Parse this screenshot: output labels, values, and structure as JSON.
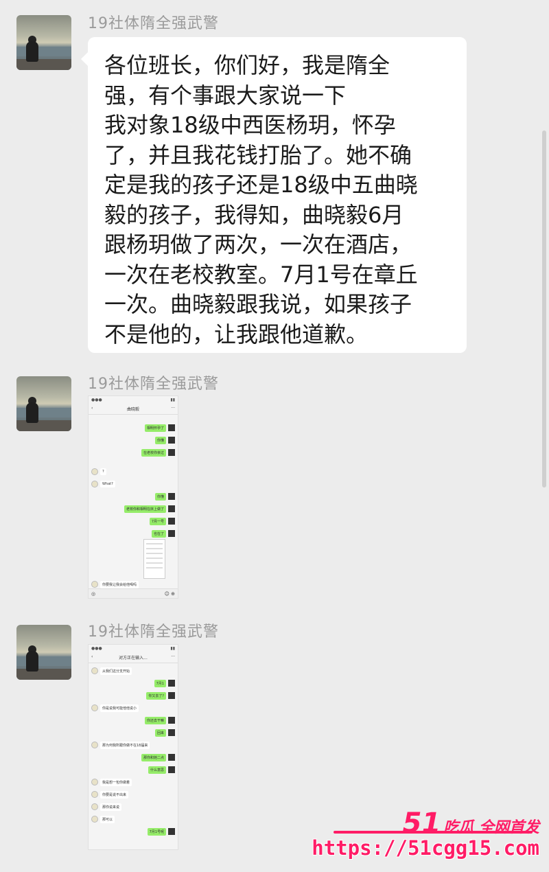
{
  "messages": [
    {
      "sender": "19社体隋全强武警",
      "text": "各位班长，你们好，我是隋全\n强，有个事跟大家说一下\n我对象18级中西医杨玥，怀孕\n了，并且我花钱打胎了。她不确\n定是我的孩子还是18级中五曲晓\n毅的孩子，我得知，曲晓毅6月\n跟杨玥做了两次，一次在酒店，\n一次在老校教室。7月1号在章丘\n一次。曲晓毅跟我说，如果孩子\n不是他的，让我跟他道歉。"
    },
    {
      "sender": "19社体隋全强武警",
      "screenshot": {
        "title": "曲晓毅",
        "me_bubbles": [
          "相明怀孕了",
          "你懂",
          "在老校你亲过",
          "你懂",
          "老校你和相明在床上做了",
          "7月一号",
          "也在了"
        ],
        "other_bubbles": [
          "?",
          "What?",
          "你要我让我会给他喝吗"
        ]
      }
    },
    {
      "sender": "19社体隋全强武警",
      "screenshot": {
        "title": "对方正在输入...",
        "me_bubbles": [
          "7月1",
          "你又去了?",
          "你还去干嘛",
          "回来",
          "那你和她二点",
          "什么意思",
          "7月1号呢"
        ],
        "other_bubbles": [
          "从我们这分支开始",
          "你是说我可能他他说小",
          "那为何我所跟你做不在18届来",
          "我是想一包你做着",
          "你要是说不出来",
          "那你说来说",
          "那可以"
        ]
      }
    }
  ],
  "watermark": {
    "number": "51",
    "tagline": "吃瓜 全网首发",
    "url": "https://51cgg15.com"
  }
}
